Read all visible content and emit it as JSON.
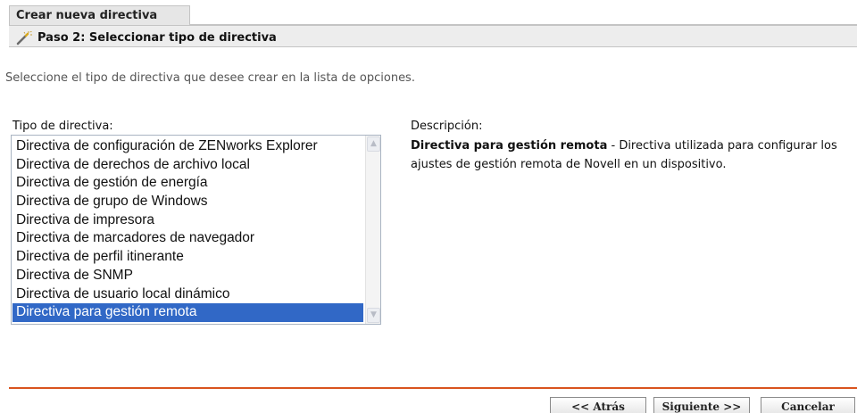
{
  "header": {
    "title": "Crear nueva directiva",
    "step": "Paso 2: Seleccionar tipo de directiva",
    "step_icon": "wand-icon"
  },
  "intro": "Seleccione el tipo de directiva que desee crear en la lista de opciones.",
  "policy_list": {
    "label": "Tipo de directiva:",
    "items": [
      "Directiva de configuración de ZENworks Explorer",
      "Directiva de derechos de archivo local",
      "Directiva de gestión de energía",
      "Directiva de grupo de Windows",
      "Directiva de impresora",
      "Directiva de marcadores de navegador",
      "Directiva de perfil itinerante",
      "Directiva de SNMP",
      "Directiva de usuario local dinámico",
      "Directiva para gestión remota"
    ],
    "selected": "Directiva para gestión remota"
  },
  "description": {
    "label": "Descripción:",
    "title": "Directiva para gestión remota",
    "text": " - Directiva utilizada para configurar los ajustes de gestión remota de Novell en un dispositivo."
  },
  "buttons": {
    "back": "<< Atrás",
    "next": "Siguiente >>",
    "cancel": "Cancelar"
  },
  "colors": {
    "selection": "#3168c6",
    "divider": "#d9541e"
  }
}
